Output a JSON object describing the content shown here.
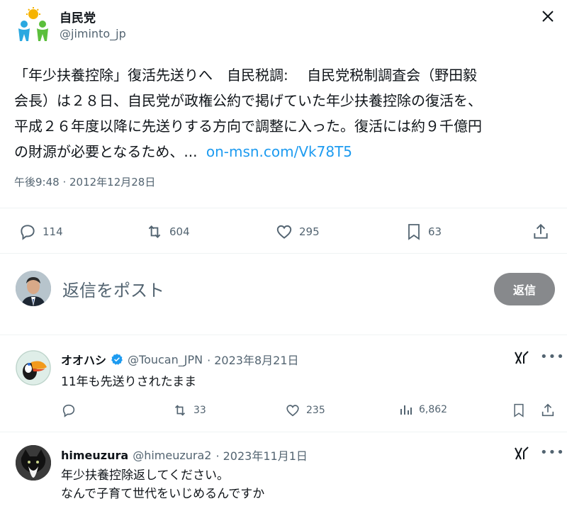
{
  "post": {
    "author_name": "自民党",
    "author_handle": "@jiminto_jp",
    "body_lines": [
      "「年少扶養控除」復活先送りへ　自民税調:　 自民党税制調査会（野田毅",
      "会長）は２８日、自民党が政権公約で掲げていた年少扶養控除の復活を、",
      "平成２６年度以降に先送りする方向で調整に入った。復活には約９千億円",
      "の財源が必要となるため、..."
    ],
    "link_text": "on-msn.com/Vk78T5",
    "timestamp": "午後9:48 · 2012年12月28日",
    "stats": {
      "replies": "114",
      "reposts": "604",
      "likes": "295",
      "bookmarks": "63"
    }
  },
  "compose": {
    "placeholder": "返信をポスト",
    "button_label": "返信"
  },
  "replies": [
    {
      "name": "オオハシ",
      "handle": "@Toucan_JPN",
      "date": "· 2023年8月21日",
      "lines": [
        "11年も先送りされたまま"
      ],
      "stats": {
        "reposts": "33",
        "likes": "235",
        "views": "6,862"
      },
      "verified": true
    },
    {
      "name": "himeuzura",
      "handle": "@himeuzura2",
      "date": "· 2023年11月1日",
      "lines": [
        "年少扶養控除返してください。",
        "なんで子育て世代をいじめるんですか"
      ],
      "verified": false
    }
  ],
  "colors": {
    "link": "#1d9bf0",
    "verified": "#1d9bf0",
    "muted": "#536471"
  },
  "icons": [
    "close-icon",
    "more-icon",
    "reply-icon",
    "repost-icon",
    "like-icon",
    "bookmark-icon",
    "share-icon",
    "views-icon",
    "grok-icon",
    "verified-icon"
  ]
}
